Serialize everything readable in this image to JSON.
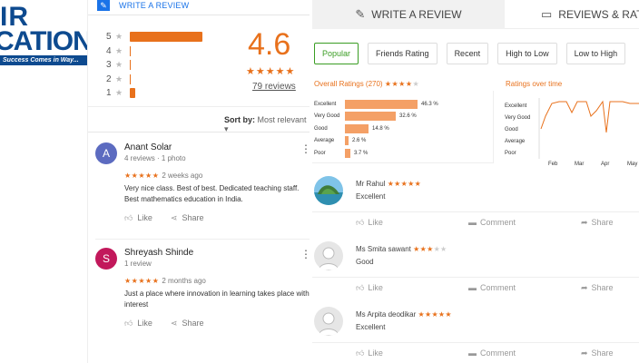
{
  "logo": {
    "line1": "IR",
    "line2": "CATION",
    "tagline": "Success Comes in Way..."
  },
  "google": {
    "write_review": "WRITE A REVIEW",
    "histogram": [
      {
        "star": "5",
        "fraction": 1.0
      },
      {
        "star": "4",
        "fraction": 0.0
      },
      {
        "star": "3",
        "fraction": 0.0
      },
      {
        "star": "2",
        "fraction": 0.0
      },
      {
        "star": "1",
        "fraction": 0.08
      }
    ],
    "average": "4.6",
    "average_stars": "★★★★★",
    "review_count": "79 reviews",
    "sort_label": "Sort by:",
    "sort_value": "Most relevant",
    "reviews": [
      {
        "initial": "A",
        "avatar_color": "#5c6bc0",
        "name": "Anant Solar",
        "meta": "4 reviews · 1 photo",
        "stars": "★★★★★",
        "when": "2 weeks ago",
        "text": "Very nice class. Best of best. Dedicated teaching staff. Best mathematics education in India.",
        "like": "Like",
        "share": "Share"
      },
      {
        "initial": "S",
        "avatar_color": "#c2185b",
        "name": "Shreyash Shinde",
        "meta": "1 review",
        "stars": "★★★★★",
        "when": "2 months ago",
        "text": "Just a place where innovation in learning takes place with interest",
        "like": "Like",
        "share": "Share"
      }
    ]
  },
  "widget": {
    "tab_write": "WRITE A REVIEW",
    "tab_reviews": "REVIEWS & RATI",
    "filters": [
      "Popular",
      "Friends Rating",
      "Recent",
      "High to Low",
      "Low to High"
    ],
    "active_filter": "Popular",
    "overall_title": "Overall Ratings (270)",
    "overall_stars_on": "★★★★",
    "overall_stars_off": "★",
    "overall": [
      {
        "label": "Excellent",
        "percent": 46.3,
        "text": "46.3 %"
      },
      {
        "label": "Very Good",
        "percent": 32.6,
        "text": "32.6 %"
      },
      {
        "label": "Good",
        "percent": 14.8,
        "text": "14.8 %"
      },
      {
        "label": "Average",
        "percent": 2.6,
        "text": "2.6 %"
      },
      {
        "label": "Poor",
        "percent": 3.7,
        "text": "3.7 %"
      }
    ],
    "ratings_over_time_title": "Ratings over time",
    "ratings_over_time": {
      "y_labels": [
        "Excellent",
        "Very Good",
        "Good",
        "Average",
        "Poor"
      ],
      "x_labels": [
        "Feb",
        "Mar",
        "Apr",
        "May"
      ]
    },
    "reviews": [
      {
        "name": "Mr Rahul",
        "stars_on": "★★★★★",
        "stars_off": "",
        "text": "Excellent",
        "has_photo": true
      },
      {
        "name": "Ms Smita sawant",
        "stars_on": "★★★",
        "stars_off": "★★",
        "text": "Good",
        "has_photo": false
      },
      {
        "name": "Ms Arpita deodikar",
        "stars_on": "★★★★★",
        "stars_off": "",
        "text": "Excellent",
        "has_photo": false
      }
    ],
    "actions": {
      "like": "Like",
      "comment": "Comment",
      "share": "Share"
    }
  },
  "colors": {
    "orange": "#e8711c",
    "green": "#3a9d23",
    "blue": "#1a73e8",
    "logo_blue": "#0d4a8f"
  }
}
